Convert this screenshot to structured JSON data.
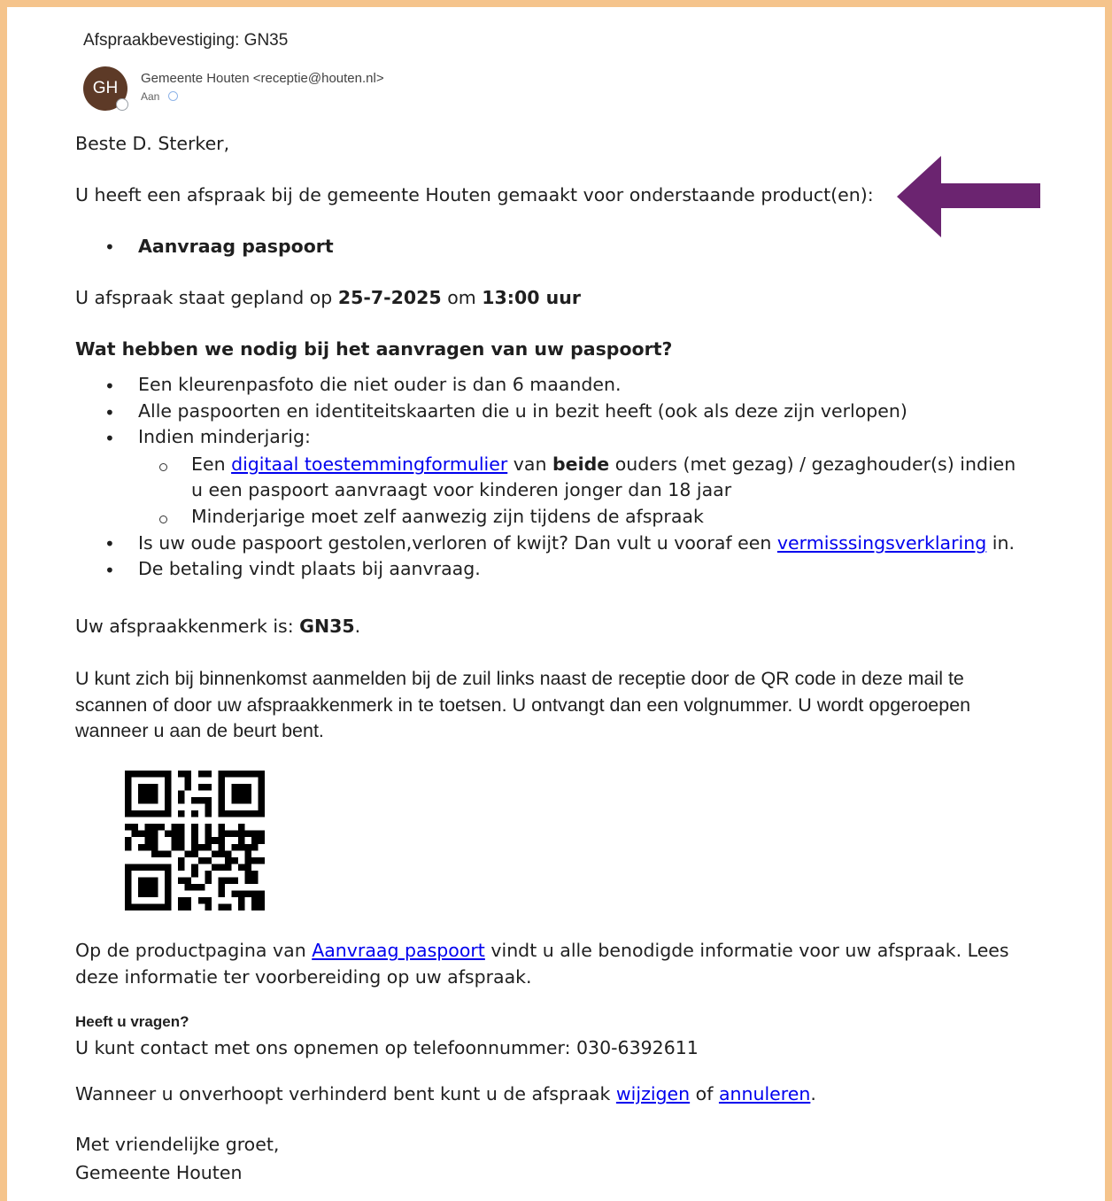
{
  "email": {
    "subject": "Afspraakbevestiging: GN35",
    "avatar_initials": "GH",
    "sender": "Gemeente Houten <receptie@houten.nl>",
    "to_label": "Aan"
  },
  "body": {
    "greeting": "Beste D. Sterker,",
    "intro": "U heeft een afspraak bij de gemeente Houten gemaakt voor onderstaande product(en):",
    "product": "Aanvraag paspoort",
    "appt_prefix": "U afspraak staat gepland op ",
    "appt_date": "25-7-2025",
    "appt_mid": " om ",
    "appt_time": "13:00 uur",
    "req_heading": "Wat hebben we nodig bij het aanvragen van uw paspoort?",
    "req_1": "Een kleurenpasfoto die niet ouder is dan 6 maanden.",
    "req_2": "Alle paspoorten en identiteitskaarten die u in bezit heeft (ook als deze zijn verlopen)",
    "req_3": "Indien minderjarig:",
    "sub_1_pre": "Een ",
    "sub_1_link": "digitaal toestemmingformulier",
    "sub_1_mid": " van ",
    "sub_1_bold": "beide",
    "sub_1_post": " ouders (met gezag) / gezaghouder(s) indien",
    "sub_1_line2": "u een paspoort aanvraagt voor kinderen jonger dan 18 jaar",
    "sub_2": "Minderjarige moet zelf aanwezig zijn tijdens de afspraak",
    "req_4_pre": "Is uw oude paspoort gestolen,verloren of kwijt? Dan vult u vooraf een ",
    "req_4_link": "vermisssingsverklaring",
    "req_4_post": " in.",
    "req_5": "De betaling vindt plaats bij aanvraag.",
    "ref_prefix": "Uw afspraakkenmerk is: ",
    "ref_code": "GN35",
    "ref_suffix": ".",
    "checkin_1": "U kunt zich bij binnenkomst aanmelden bij de zuil links naast de receptie door de QR code in deze mail te",
    "checkin_2": "scannen of door uw afspraakkenmerk in te toetsen. U ontvangt dan een volgnummer. U wordt opgeroepen",
    "checkin_3": "wanneer u aan de beurt bent.",
    "info_pre": "Op de productpagina van ",
    "info_link": "Aanvraag paspoort",
    "info_post": " vindt u alle benodigde informatie voor uw afspraak. Lees",
    "info_line2": "deze informatie ter voorbereiding op uw afspraak.",
    "questions_heading": "Heeft u vragen?",
    "contact": "U kunt contact met ons opnemen op telefoonnummer: 030-6392611",
    "change_pre": "Wanneer u onverhoopt verhinderd bent kunt u de afspraak ",
    "change_link": "wijzigen",
    "change_mid": " of ",
    "cancel_link": "annuleren",
    "change_post": ".",
    "closing": "Met vriendelijke groet,",
    "signature": "Gemeente Houten"
  },
  "colors": {
    "frame_border": "#f5c48c",
    "arrow": "#6b2470",
    "avatar_bg": "#5d3a27",
    "link": "#0000ee"
  },
  "icons": {
    "annotation_arrow": "left-arrow-icon",
    "presence_status": "presence-status-icon",
    "qr": "qr-code"
  }
}
